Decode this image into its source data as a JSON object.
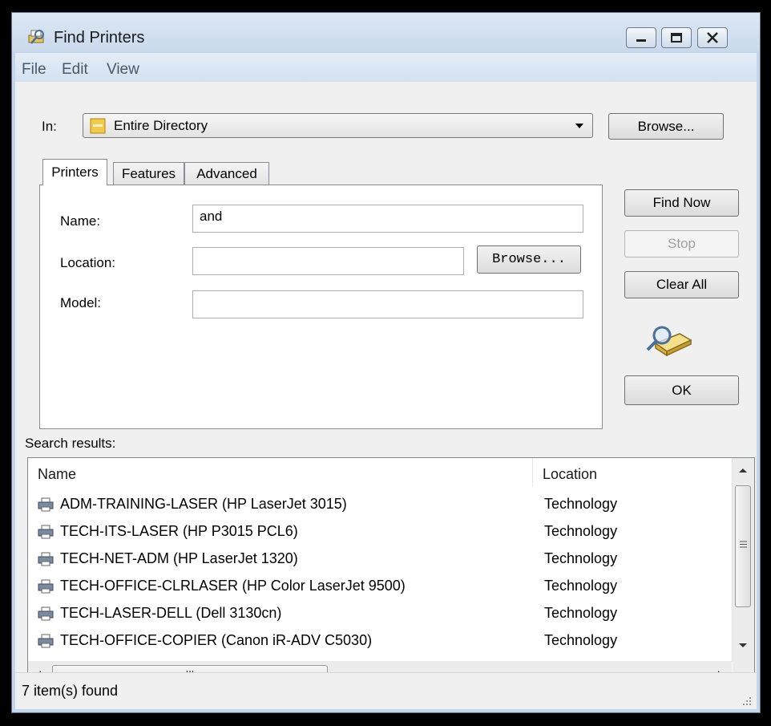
{
  "window": {
    "title": "Find Printers",
    "title_icon": "find-printer-icon",
    "controls": {
      "minimize": "minimize-icon",
      "maximize": "maximize-icon",
      "close": "close-icon"
    }
  },
  "menu": [
    "File",
    "Edit",
    "View"
  ],
  "scope": {
    "label": "In:",
    "value": "Entire Directory",
    "icon": "directory-icon",
    "browse_label": "Browse..."
  },
  "tabs": [
    {
      "label": "Printers",
      "active": true
    },
    {
      "label": "Features",
      "active": false
    },
    {
      "label": "Advanced",
      "active": false
    }
  ],
  "form": {
    "name_label": "Name:",
    "name_value": "and",
    "location_label": "Location:",
    "location_value": "",
    "location_browse_label": "Browse...",
    "model_label": "Model:",
    "model_value": ""
  },
  "actions": {
    "find_now": "Find Now",
    "stop": "Stop",
    "clear_all": "Clear All",
    "ok": "OK",
    "search_icon": "magnifier-printer-icon"
  },
  "results": {
    "label": "Search results:",
    "columns": [
      "Name",
      "Location"
    ],
    "rows": [
      {
        "name": "ADM-TRAINING-LASER (HP LaserJet 3015)",
        "location": "Technology"
      },
      {
        "name": "TECH-ITS-LASER (HP P3015 PCL6)",
        "location": "Technology"
      },
      {
        "name": "TECH-NET-ADM (HP LaserJet 1320)",
        "location": "Technology"
      },
      {
        "name": "TECH-OFFICE-CLRLASER (HP Color LaserJet 9500)",
        "location": "Technology"
      },
      {
        "name": "TECH-LASER-DELL (Dell 3130cn)",
        "location": "Technology"
      },
      {
        "name": "TECH-OFFICE-COPIER (Canon iR-ADV C5030)",
        "location": "Technology"
      }
    ],
    "hscroll_grip": "III"
  },
  "status": "7 item(s) found",
  "colors": {
    "title_bg": "#c9d9ec",
    "dialog_bg": "#f0f0f0",
    "border": "#898c95"
  }
}
